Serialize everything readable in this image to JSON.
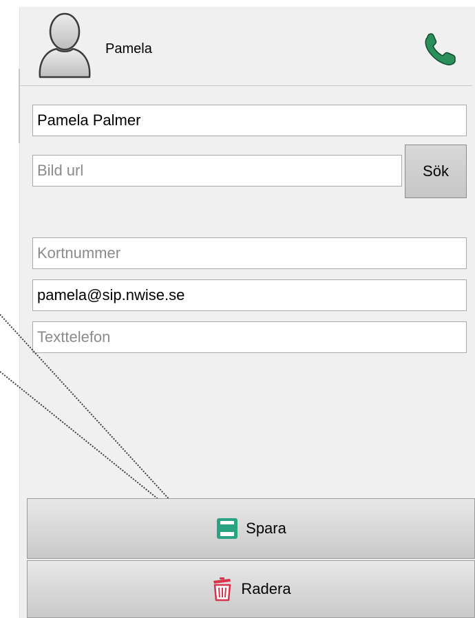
{
  "header": {
    "contact_name": "Pamela",
    "avatar_icon": "person-silhouette-icon",
    "call_icon": "phone-icon",
    "call_icon_color": "#2a8f5a"
  },
  "form": {
    "full_name_value": "Pamela Palmer",
    "image_url_placeholder": "Bild url",
    "search_button_label": "Sök",
    "short_number_placeholder": "Kortnummer",
    "sip_address_value": "pamela@sip.nwise.se",
    "text_phone_placeholder": "Texttelefon"
  },
  "actions": {
    "save_label": "Spara",
    "save_icon": "save-icon",
    "save_icon_color": "#2aa382",
    "delete_label": "Radera",
    "delete_icon": "trash-icon",
    "delete_icon_color": "#d8324a"
  }
}
